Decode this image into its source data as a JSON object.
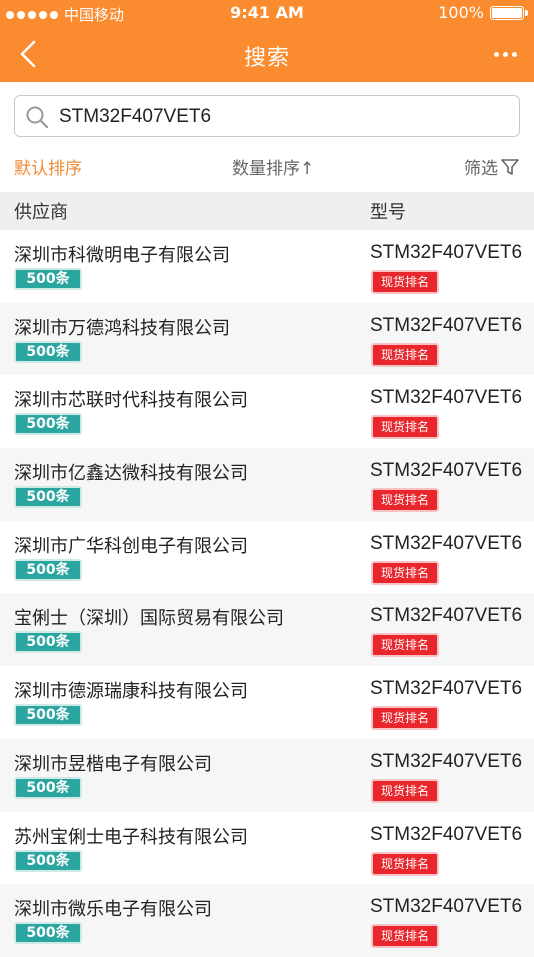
{
  "status_bar": {
    "carrier": "中国移动",
    "time": "9:41 AM",
    "battery": "100%"
  },
  "nav": {
    "title": "搜索"
  },
  "search": {
    "value": "STM32F407VET6"
  },
  "sort": {
    "default": "默认排序",
    "quantity": "数量排序↑",
    "filter": "筛选"
  },
  "table": {
    "headers": {
      "supplier": "供应商",
      "model": "型号"
    },
    "rows": [
      {
        "supplier": "深圳市科微明电子有限公司",
        "count": "500条",
        "model": "STM32F407VET6",
        "badge": "现货排名"
      },
      {
        "supplier": "深圳市万德鸿科技有限公司",
        "count": "500条",
        "model": "STM32F407VET6",
        "badge": "现货排名"
      },
      {
        "supplier": "深圳市芯联时代科技有限公司",
        "count": "500条",
        "model": "STM32F407VET6",
        "badge": "现货排名"
      },
      {
        "supplier": "深圳市亿鑫达微科技有限公司",
        "count": "500条",
        "model": "STM32F407VET6",
        "badge": "现货排名"
      },
      {
        "supplier": "深圳市广华科创电子有限公司",
        "count": "500条",
        "model": "STM32F407VET6",
        "badge": "现货排名"
      },
      {
        "supplier": "宝俐士（深圳）国际贸易有限公司",
        "count": "500条",
        "model": "STM32F407VET6",
        "badge": "现货排名"
      },
      {
        "supplier": "深圳市德源瑞康科技有限公司",
        "count": "500条",
        "model": "STM32F407VET6",
        "badge": "现货排名"
      },
      {
        "supplier": "深圳市昱楷电子有限公司",
        "count": "500条",
        "model": "STM32F407VET6",
        "badge": "现货排名"
      },
      {
        "supplier": "苏州宝俐士电子科技有限公司",
        "count": "500条",
        "model": "STM32F407VET6",
        "badge": "现货排名"
      },
      {
        "supplier": "深圳市微乐电子有限公司",
        "count": "500条",
        "model": "STM32F407VET6",
        "badge": "现货排名"
      }
    ]
  },
  "colors": {
    "brand": "#fb8b2f",
    "accent_text": "#f08a35",
    "count_badge": "#2aa5a0",
    "rank_badge": "#e8262b"
  }
}
